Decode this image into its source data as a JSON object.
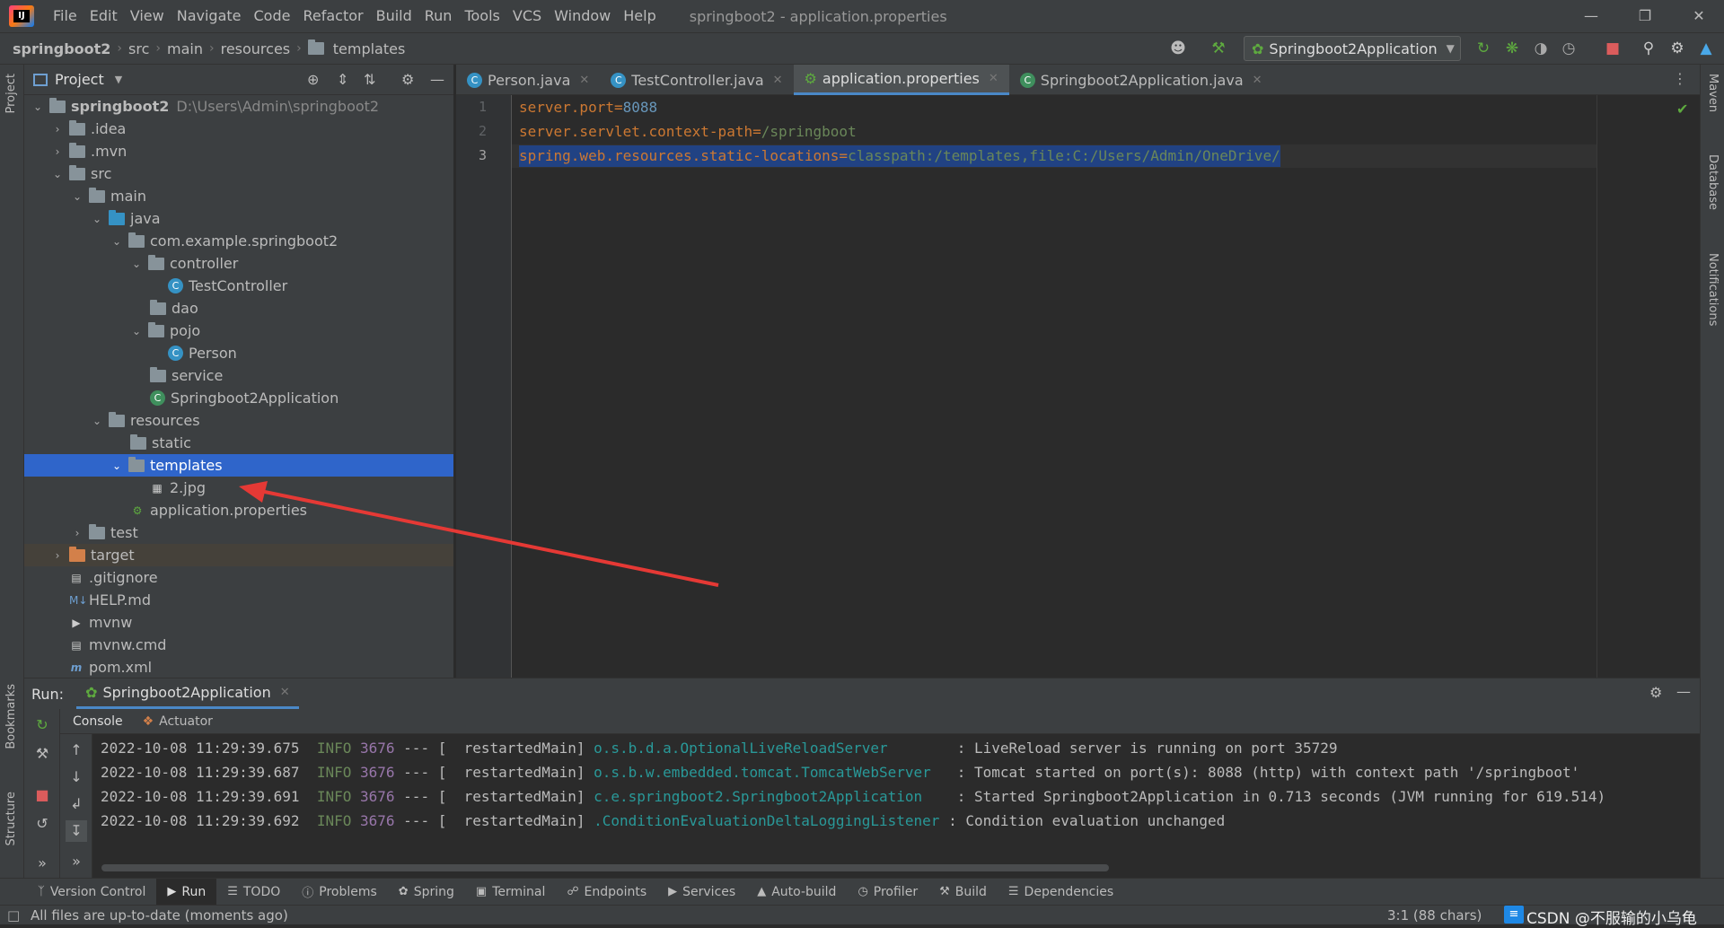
{
  "menu": [
    "File",
    "Edit",
    "View",
    "Navigate",
    "Code",
    "Refactor",
    "Build",
    "Run",
    "Tools",
    "VCS",
    "Window",
    "Help"
  ],
  "window_title": "springboot2 - application.properties",
  "breadcrumbs": [
    "springboot2",
    "src",
    "main",
    "resources",
    "templates"
  ],
  "run_config": "Springboot2Application",
  "project_panel": {
    "title": "Project",
    "tree": [
      {
        "label": "springboot2",
        "extra": "D:\\Users\\Admin\\springboot2"
      },
      {
        "label": ".idea"
      },
      {
        "label": ".mvn"
      },
      {
        "label": "src"
      },
      {
        "label": "main"
      },
      {
        "label": "java"
      },
      {
        "label": "com.example.springboot2"
      },
      {
        "label": "controller"
      },
      {
        "label": "TestController"
      },
      {
        "label": "dao"
      },
      {
        "label": "pojo"
      },
      {
        "label": "Person"
      },
      {
        "label": "service"
      },
      {
        "label": "Springboot2Application"
      },
      {
        "label": "resources"
      },
      {
        "label": "static"
      },
      {
        "label": "templates"
      },
      {
        "label": "2.jpg"
      },
      {
        "label": "application.properties"
      },
      {
        "label": "test"
      },
      {
        "label": "target"
      },
      {
        "label": ".gitignore"
      },
      {
        "label": "HELP.md"
      },
      {
        "label": "mvnw"
      },
      {
        "label": "mvnw.cmd"
      },
      {
        "label": "pom.xml"
      }
    ]
  },
  "tabs": [
    {
      "label": "Person.java"
    },
    {
      "label": "TestController.java"
    },
    {
      "label": "application.properties"
    },
    {
      "label": "Springboot2Application.java"
    }
  ],
  "editor": {
    "lines": [
      {
        "no": "1",
        "key": "server.port",
        "eq": "=",
        "value": "8088"
      },
      {
        "no": "2",
        "key": "server.servlet.context-path",
        "eq": "=",
        "value": "/springboot"
      },
      {
        "no": "3",
        "key": "spring.web.resources.static-locations",
        "eq": "=",
        "value": "classpath:/templates,file:C:/Users/Admin/OneDrive/"
      }
    ]
  },
  "run_panel": {
    "label": "Run:",
    "tab": "Springboot2Application",
    "subtabs": [
      "Console",
      "Actuator"
    ],
    "log": [
      {
        "date": "2022-10-08 11:29:39.675",
        "level": "INFO",
        "pid": "3676",
        "sep": "--- [",
        "thread": "  restartedMain]",
        "cls": "o.s.b.d.a.OptionalLiveReloadServer       ",
        "msg": ": LiveReload server is running on port 35729"
      },
      {
        "date": "2022-10-08 11:29:39.687",
        "level": "INFO",
        "pid": "3676",
        "sep": "--- [",
        "thread": "  restartedMain]",
        "cls": "o.s.b.w.embedded.tomcat.TomcatWebServer  ",
        "msg": ": Tomcat started on port(s): 8088 (http) with context path '/springboot'"
      },
      {
        "date": "2022-10-08 11:29:39.691",
        "level": "INFO",
        "pid": "3676",
        "sep": "--- [",
        "thread": "  restartedMain]",
        "cls": "c.e.springboot2.Springboot2Application   ",
        "msg": ": Started Springboot2Application in 0.713 seconds (JVM running for 619.514)"
      },
      {
        "date": "2022-10-08 11:29:39.692",
        "level": "INFO",
        "pid": "3676",
        "sep": "--- [",
        "thread": "  restartedMain]",
        "cls": ".ConditionEvaluationDeltaLoggingListener",
        "msg": ": Condition evaluation unchanged"
      }
    ]
  },
  "tool_windows": [
    "Version Control",
    "Run",
    "TODO",
    "Problems",
    "Spring",
    "Terminal",
    "Endpoints",
    "Services",
    "Auto-build",
    "Profiler",
    "Build",
    "Dependencies"
  ],
  "status": {
    "message": "All files are up-to-date (moments ago)",
    "position": "3:1 (88 chars)",
    "watermark": "CSDN @不服输的小乌龟"
  },
  "side_labels": {
    "left": [
      "Project",
      "Bookmarks",
      "Structure"
    ],
    "right": [
      "Maven",
      "Database",
      "Notifications"
    ]
  },
  "colors": {
    "selection": "#2f65ca",
    "keyword": "#cc7832",
    "string": "#6a8759",
    "number": "#6897bb",
    "annotation_arrow": "#e53935"
  }
}
